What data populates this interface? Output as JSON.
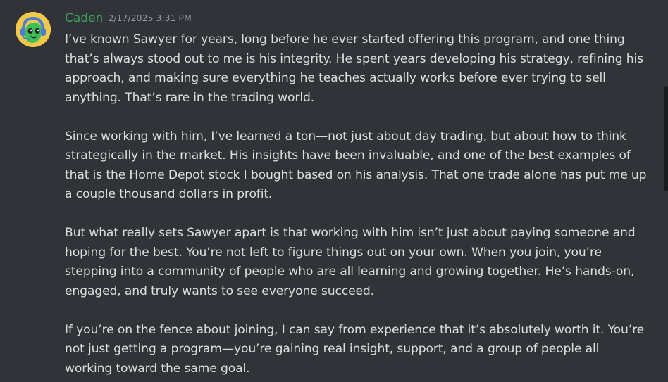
{
  "message": {
    "author": "Caden",
    "timestamp": "2/17/2025 3:31 PM",
    "avatar_icon": "green-headset-avatar",
    "author_color": "#3ba55d",
    "paragraphs": [
      "I’ve known Sawyer for years, long before he ever started offering this program, and one thing that’s always stood out to me is his integrity. He spent years developing his strategy, refining his approach, and making sure everything he teaches actually works before ever trying to sell anything. That’s rare in the trading world.",
      "Since working with him, I’ve learned a ton—not just about day trading, but about how to think strategically in the market. His insights have been invaluable, and one of the best examples of that is the Home Depot stock I bought based on his analysis. That one trade alone has put me up a couple thousand dollars in profit.",
      "But what really sets Sawyer apart is that working with him isn’t just about paying someone and hoping for the best. You’re not left to figure things out on your own. When you join, you’re stepping into a community of people who are all learning and growing together. He’s hands-on, engaged, and truly wants to see everyone succeed.",
      "If you’re on the fence about joining, I can say from experience that it’s absolutely worth it. You’re not just getting a program—you’re gaining real insight, support, and a group of people all working toward the same goal."
    ]
  },
  "theme": {
    "background": "#313338",
    "text": "#dbdee1",
    "muted": "#949ba4"
  }
}
